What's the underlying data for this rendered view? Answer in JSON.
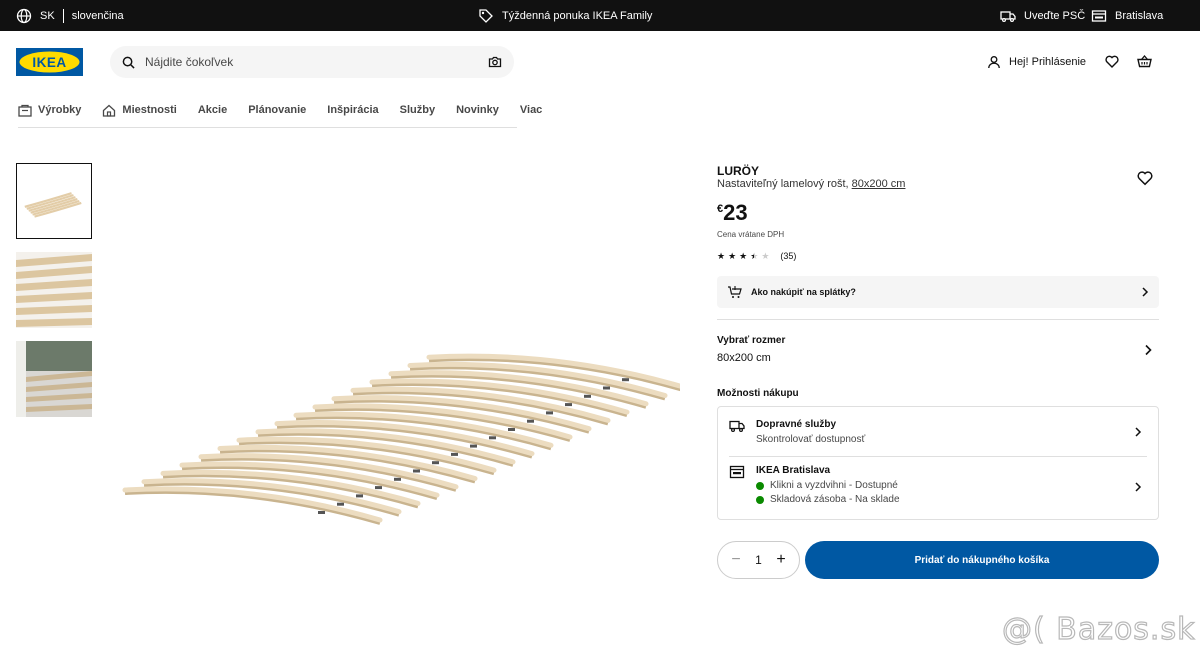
{
  "topbar": {
    "language_code": "SK",
    "language_name": "slovenčina",
    "promo": "Týždenná ponuka IKEA Family",
    "postcode": "Uveďte PSČ",
    "store": "Bratislava"
  },
  "header": {
    "logo_text": "IKEA",
    "search_placeholder": "Nájdite čokoľvek",
    "login": "Hej! Prihlásenie"
  },
  "nav": {
    "items": [
      "Výrobky",
      "Miestnosti",
      "Akcie",
      "Plánovanie",
      "Inšpirácia",
      "Služby",
      "Novinky",
      "Viac"
    ]
  },
  "product": {
    "name": "LURÖY",
    "description": "Nastaviteľný lamelový rošt, ",
    "size_link": "80x200 cm",
    "currency": "€",
    "price": "23",
    "vat_note": "Cena vrátane DPH",
    "rating": 3.5,
    "rating_max": 5,
    "review_count": "(35)",
    "installment": "Ako nakúpiť na splátky?"
  },
  "size": {
    "title": "Vybrať rozmer",
    "value": "80x200 cm"
  },
  "purchase_options": {
    "title": "Možnosti nákupu",
    "delivery_title": "Dopravné služby",
    "delivery_sub": "Skontrolovať dostupnosť",
    "store_title": "IKEA Bratislava",
    "click_collect": "Klikni a vyzdvihni - Dostupné",
    "stock": "Skladová zásoba - Na sklade"
  },
  "cart": {
    "quantity": "1",
    "minus": "−",
    "plus": "+",
    "add_label": "Pridať do nákupného košíka"
  },
  "watermark": "@( Bazos.sk",
  "colors": {
    "topbar": "#111111",
    "primary_blue": "#0058a3",
    "logo_blue": "#0058a3",
    "logo_yellow": "#ffdb00",
    "stock_green": "#0a8a00"
  }
}
